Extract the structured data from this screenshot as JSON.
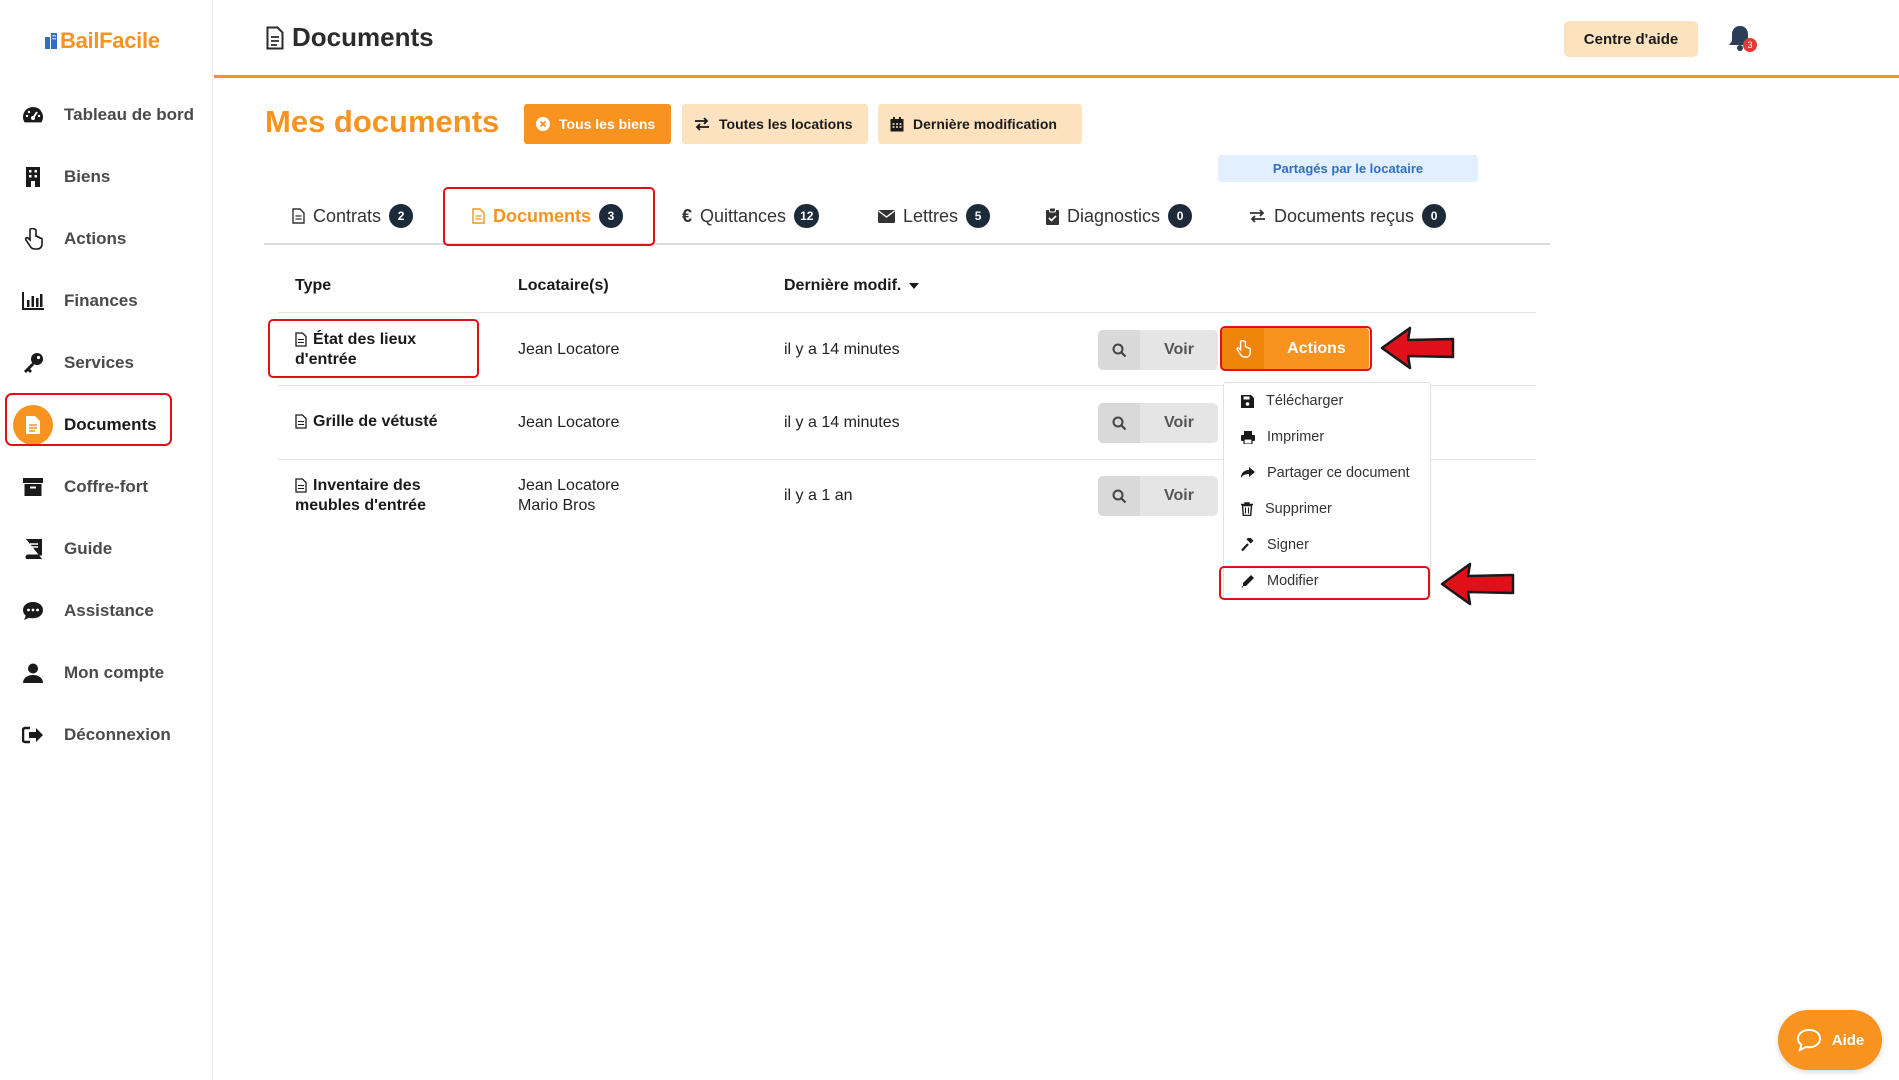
{
  "app": {
    "logo_text": "BailFacile"
  },
  "sidebar": {
    "items": [
      {
        "label": "Tableau de bord",
        "icon": "gauge-icon"
      },
      {
        "label": "Biens",
        "icon": "building-icon"
      },
      {
        "label": "Actions",
        "icon": "hand-pointer-icon"
      },
      {
        "label": "Finances",
        "icon": "chart-bar-icon"
      },
      {
        "label": "Services",
        "icon": "key-icon"
      },
      {
        "label": "Documents",
        "icon": "document-icon",
        "active": true
      },
      {
        "label": "Coffre-fort",
        "icon": "archive-box-icon"
      },
      {
        "label": "Guide",
        "icon": "book-icon"
      },
      {
        "label": "Assistance",
        "icon": "chat-bubble-icon"
      },
      {
        "label": "Mon compte",
        "icon": "user-icon"
      },
      {
        "label": "Déconnexion",
        "icon": "sign-out-icon"
      }
    ]
  },
  "header": {
    "title": "Documents",
    "help_label": "Centre d'aide",
    "notification_count": "3"
  },
  "page": {
    "title": "Mes documents",
    "filters": [
      {
        "label": "Tous les biens",
        "icon": "times-circle-icon"
      },
      {
        "label": "Toutes les locations",
        "icon": "exchange-icon"
      },
      {
        "label": "Dernière modification",
        "icon": "calendar-icon"
      }
    ],
    "shared_tag": "Partagés par le locataire"
  },
  "tabs": [
    {
      "label": "Contrats",
      "count": "2",
      "icon": "document-icon"
    },
    {
      "label": "Documents",
      "count": "3",
      "icon": "document-icon",
      "active": true
    },
    {
      "label": "Quittances",
      "count": "12",
      "icon": "euro-icon"
    },
    {
      "label": "Lettres",
      "count": "5",
      "icon": "envelope-icon"
    },
    {
      "label": "Diagnostics",
      "count": "0",
      "icon": "clipboard-check-icon"
    },
    {
      "label": "Documents reçus",
      "count": "0",
      "icon": "exchange-icon"
    }
  ],
  "table": {
    "columns": [
      "Type",
      "Locataire(s)",
      "Dernière modif."
    ],
    "rows": [
      {
        "type_line1": "État des lieux",
        "type_line2": "d'entrée",
        "tenant_line1": "Jean Locatore",
        "tenant_line2": "",
        "modified": "il y a 14 minutes"
      },
      {
        "type_line1": "Grille de vétusté",
        "type_line2": "",
        "tenant_line1": "Jean Locatore",
        "tenant_line2": "",
        "modified": "il y a 14 minutes"
      },
      {
        "type_line1": "Inventaire des",
        "type_line2": "meubles d'entrée",
        "tenant_line1": "Jean Locatore",
        "tenant_line2": "Mario Bros",
        "modified": "il y a 1 an"
      }
    ],
    "view_label": "Voir",
    "actions_label": "Actions"
  },
  "dropdown": {
    "items": [
      {
        "label": "Télécharger",
        "icon": "save-icon"
      },
      {
        "label": "Imprimer",
        "icon": "print-icon"
      },
      {
        "label": "Partager ce document",
        "icon": "share-icon"
      },
      {
        "label": "Supprimer",
        "icon": "trash-icon"
      },
      {
        "label": "Signer",
        "icon": "gavel-icon"
      },
      {
        "label": "Modifier",
        "icon": "pencil-icon"
      }
    ]
  },
  "floating": {
    "aide_label": "Aide"
  },
  "colors": {
    "accent": "#f7931e",
    "accent_light": "#fde2bf",
    "highlight": "#e0101a",
    "badge": "#1c2a3a"
  }
}
